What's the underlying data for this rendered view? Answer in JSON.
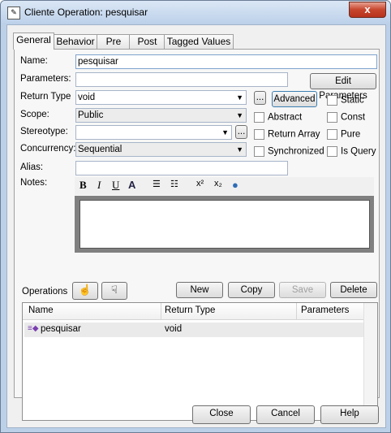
{
  "window": {
    "title": "Cliente Operation: pesquisar",
    "close_glyph": "x"
  },
  "tabs": [
    {
      "label": "General"
    },
    {
      "label": "Behavior"
    },
    {
      "label": "Pre"
    },
    {
      "label": "Post"
    },
    {
      "label": "Tagged Values"
    }
  ],
  "form": {
    "name_label": "Name:",
    "name_value": "pesquisar",
    "parameters_label": "Parameters:",
    "parameters_value": "",
    "edit_parameters_button": "Edit Parameters",
    "return_type_label": "Return Type",
    "return_type_value": "void",
    "ellipsis": "...",
    "advanced_button": "Advanced",
    "scope_label": "Scope:",
    "scope_value": "Public",
    "stereotype_label": "Stereotype:",
    "stereotype_value": "",
    "concurrency_label": "Concurrency:",
    "concurrency_value": "Sequential",
    "alias_label": "Alias:",
    "alias_value": "",
    "notes_label": "Notes:",
    "checkboxes": {
      "static": "Static",
      "abstract": "Abstract",
      "const": "Const",
      "return_array": "Return Array",
      "pure": "Pure",
      "synchronized": "Synchronized",
      "is_query": "Is Query"
    }
  },
  "notes_toolbar": {
    "bold": "B",
    "italic": "I",
    "underline": "U",
    "superscript": "x²",
    "subscript": "x₂"
  },
  "operations": {
    "label": "Operations",
    "new_button": "New",
    "copy_button": "Copy",
    "save_button": "Save",
    "delete_button": "Delete",
    "columns": [
      "Name",
      "Return Type",
      "Parameters"
    ],
    "rows": [
      {
        "name": "pesquisar",
        "return_type": "void",
        "parameters": ""
      }
    ]
  },
  "footer": {
    "close_button": "Close",
    "cancel_button": "Cancel",
    "help_button": "Help"
  }
}
